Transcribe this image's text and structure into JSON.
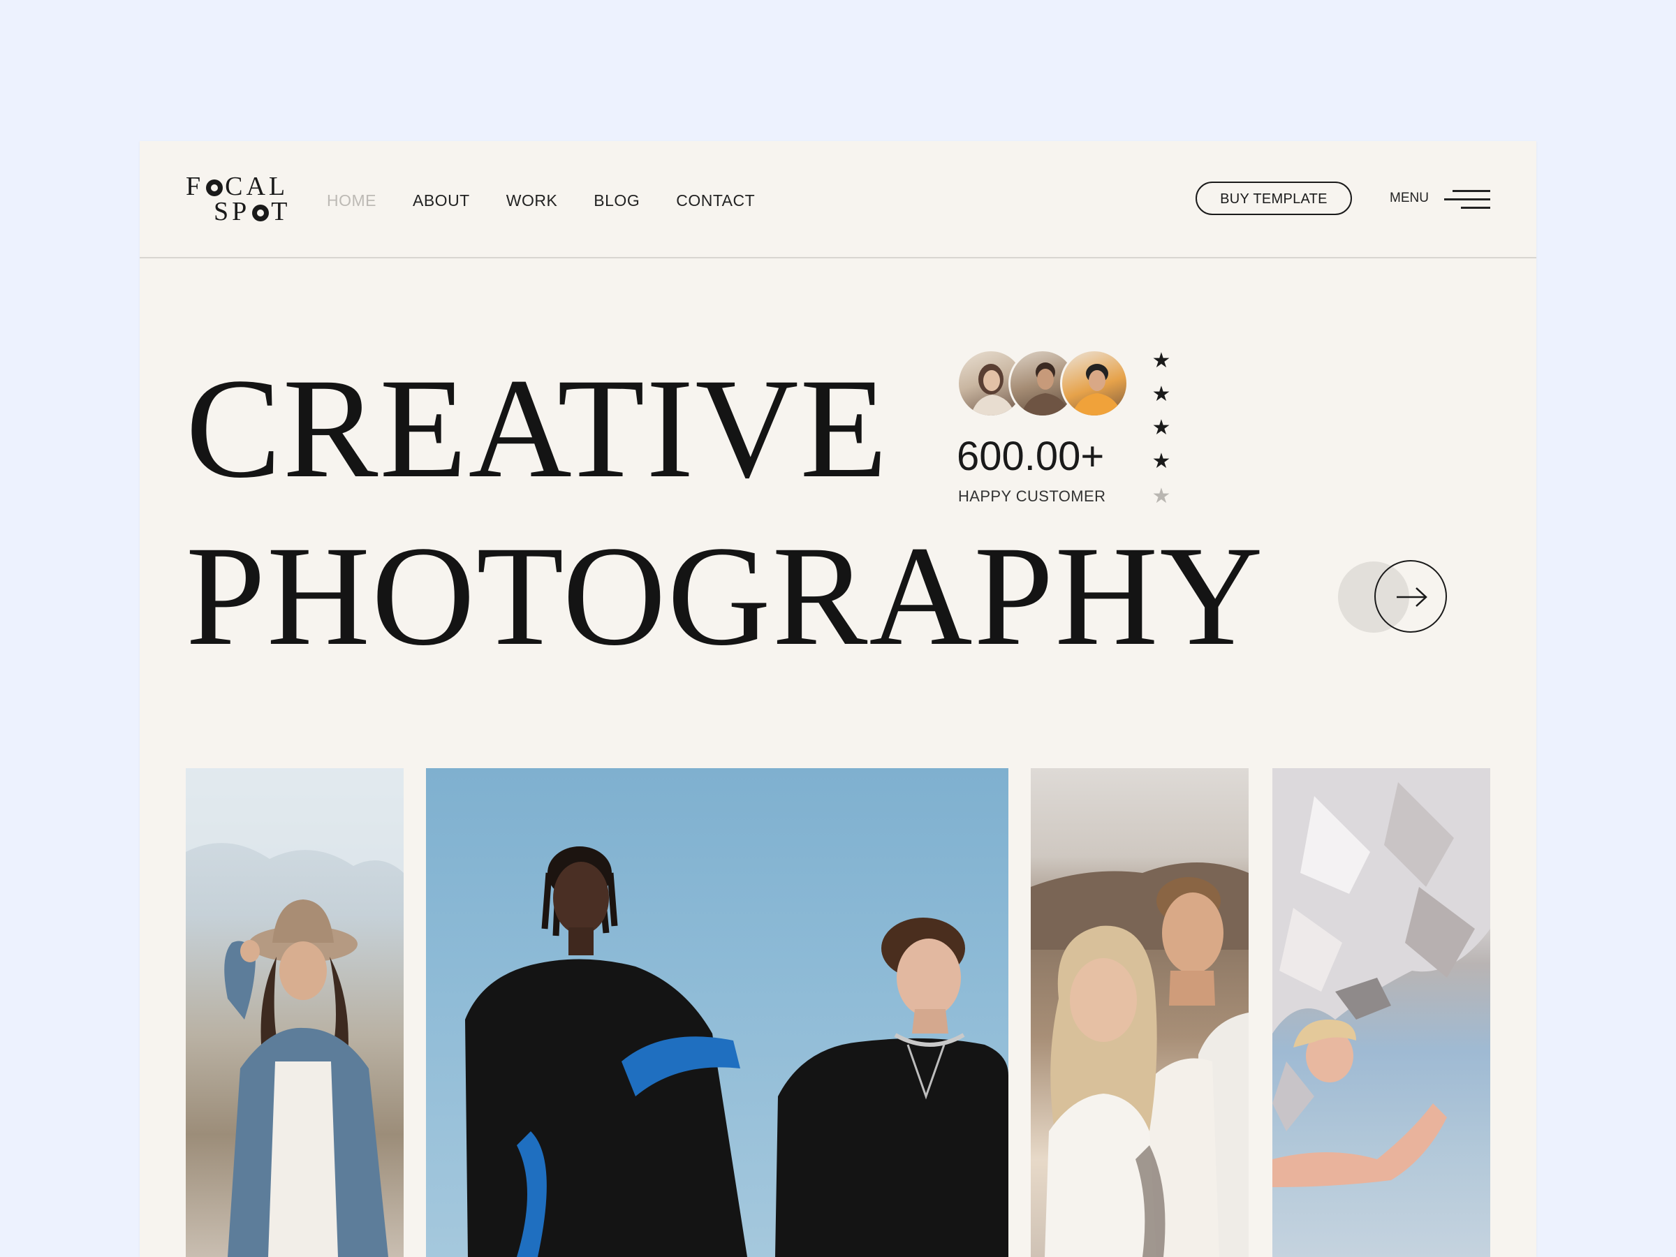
{
  "logo": {
    "line1_pre": "F",
    "line1_post": "CAL",
    "line2_pre": "SP",
    "line2_post": "T"
  },
  "nav": {
    "items": [
      {
        "label": "HOME",
        "active": true
      },
      {
        "label": "ABOUT",
        "active": false
      },
      {
        "label": "WORK",
        "active": false
      },
      {
        "label": "BLOG",
        "active": false
      },
      {
        "label": "CONTACT",
        "active": false
      }
    ]
  },
  "header": {
    "buy_label": "BUY TEMPLATE",
    "menu_label": "MENU"
  },
  "hero": {
    "title_line1": "CREATIVE",
    "title_line2": "PHOTOGRAPHY",
    "stat_value": "600.00+",
    "stat_label": "HAPPY CUSTOMER",
    "rating": 4,
    "rating_max": 5,
    "arrow_icon": "arrow-right-icon"
  },
  "gallery": {
    "photos": [
      {
        "subject": "woman-in-hat-denim-jacket"
      },
      {
        "subject": "two-men-black-hoodies-blue-sky"
      },
      {
        "subject": "couple-embracing"
      },
      {
        "subject": "woman-under-silver-foil"
      }
    ]
  },
  "colors": {
    "background": "#edf2fe",
    "page": "#f7f4ef",
    "text": "#1a1a1a",
    "muted": "#bdbab5"
  }
}
